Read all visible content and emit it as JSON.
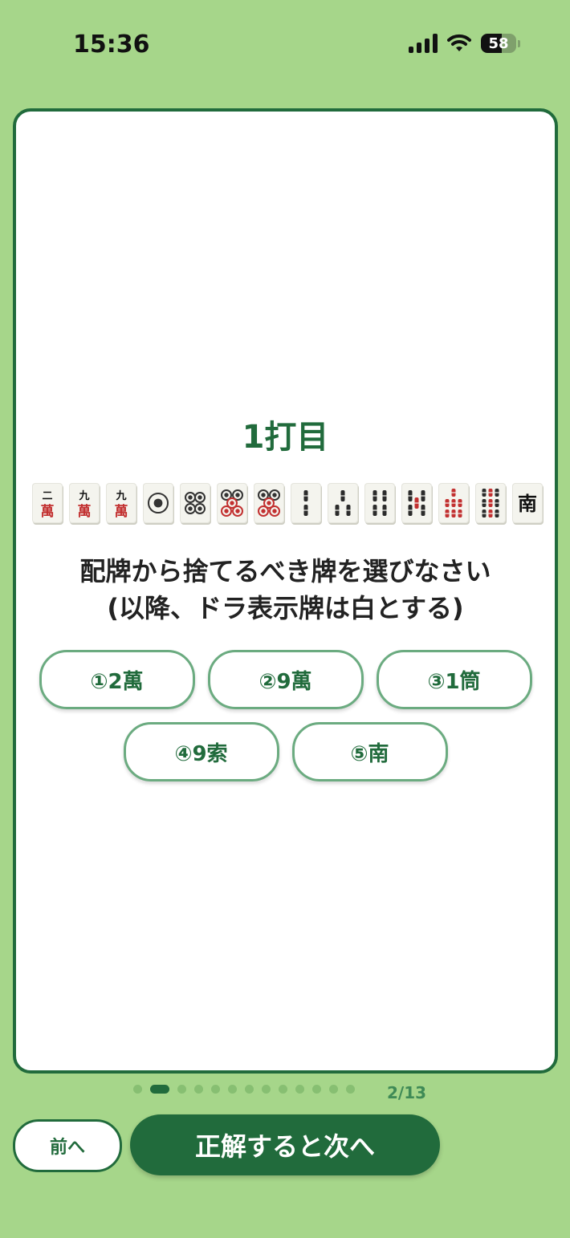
{
  "status_bar": {
    "time": "15:36",
    "battery": "58"
  },
  "question": {
    "title": "1打目",
    "line1": "配牌から捨てるべき牌を選びなさい",
    "line2": "(以降、ドラ表示牌は白とする)"
  },
  "tiles": [
    {
      "name": "2-man-tile",
      "suit": "man",
      "top": "二"
    },
    {
      "name": "9-man-tile",
      "suit": "man",
      "top": "九"
    },
    {
      "name": "9-man-tile",
      "suit": "man",
      "top": "九"
    },
    {
      "name": "1-pin-tile",
      "suit": "pin",
      "count": 1
    },
    {
      "name": "4-pin-tile",
      "suit": "pin",
      "count": 4
    },
    {
      "name": "5-pin-tile",
      "suit": "pin",
      "count": 5
    },
    {
      "name": "5-pin-tile",
      "suit": "pin",
      "count": 5
    },
    {
      "name": "2-sou-tile",
      "suit": "sou",
      "count": 2
    },
    {
      "name": "3-sou-tile",
      "suit": "sou",
      "count": 3
    },
    {
      "name": "4-sou-tile",
      "suit": "sou",
      "count": 4
    },
    {
      "name": "5-sou-tile",
      "suit": "sou",
      "count": 5
    },
    {
      "name": "7-sou-tile",
      "suit": "sou",
      "count": 7
    },
    {
      "name": "9-sou-tile",
      "suit": "sou",
      "count": 9
    },
    {
      "name": "south-tile",
      "suit": "honor",
      "glyph": "南"
    }
  ],
  "options": [
    {
      "label": "①2萬"
    },
    {
      "label": "②9萬"
    },
    {
      "label": "③1筒"
    },
    {
      "label": "④9索"
    },
    {
      "label": "⑤南"
    }
  ],
  "pagination": {
    "current": 2,
    "total": 13,
    "label": "2/13"
  },
  "buttons": {
    "prev": "前へ",
    "next": "正解すると次へ"
  },
  "colors": {
    "background": "#a6d68a",
    "primary": "#216b3c",
    "option_border": "#6bab80",
    "tile_red": "#c23030"
  }
}
